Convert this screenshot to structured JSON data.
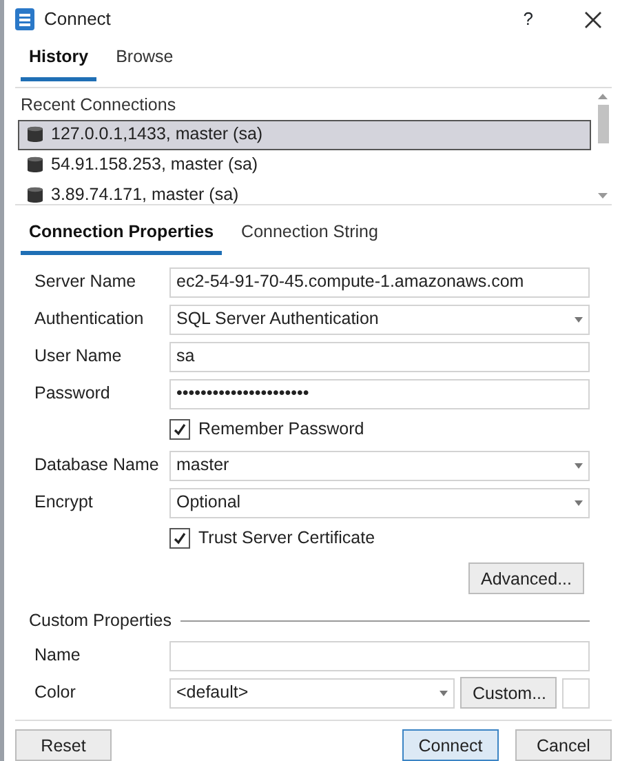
{
  "window": {
    "title": "Connect",
    "help": "?"
  },
  "top_tabs": [
    {
      "label": "History",
      "selected": true
    },
    {
      "label": "Browse",
      "selected": false
    }
  ],
  "recent": {
    "heading": "Recent Connections",
    "items": [
      {
        "label": "127.0.0.1,1433, master (sa)",
        "selected": true
      },
      {
        "label": "54.91.158.253, master (sa)",
        "selected": false
      },
      {
        "label": "3.89.74.171, master (sa)",
        "selected": false
      }
    ]
  },
  "prop_tabs": [
    {
      "label": "Connection Properties",
      "selected": true
    },
    {
      "label": "Connection String",
      "selected": false
    }
  ],
  "fields": [
    {
      "kind": "text",
      "label": "Server Name",
      "value": "ec2-54-91-70-45.compute-1.amazonaws.com"
    },
    {
      "kind": "select",
      "label": "Authentication",
      "value": "SQL Server Authentication"
    },
    {
      "kind": "text",
      "label": "User Name",
      "value": "sa"
    },
    {
      "kind": "text",
      "label": "Password",
      "value": "••••••••••••••••••••••",
      "option": {
        "label": "Remember Password",
        "checked": true
      }
    },
    {
      "kind": "select",
      "label": "Database Name",
      "value": "master"
    },
    {
      "kind": "select",
      "label": "Encrypt",
      "value": "Optional",
      "option": {
        "label": "Trust Server Certificate",
        "checked": true
      }
    },
    {
      "kind": "button",
      "label": "Advanced..."
    }
  ],
  "custom": {
    "title": "Custom Properties",
    "name_label": "Name",
    "color_label": "Color",
    "color_value": "<default>",
    "custom_button": "Custom..."
  },
  "footer": [
    {
      "label": "Reset",
      "default": false
    },
    {
      "label": "Connect",
      "default": true
    },
    {
      "label": "Cancel",
      "default": false
    }
  ]
}
